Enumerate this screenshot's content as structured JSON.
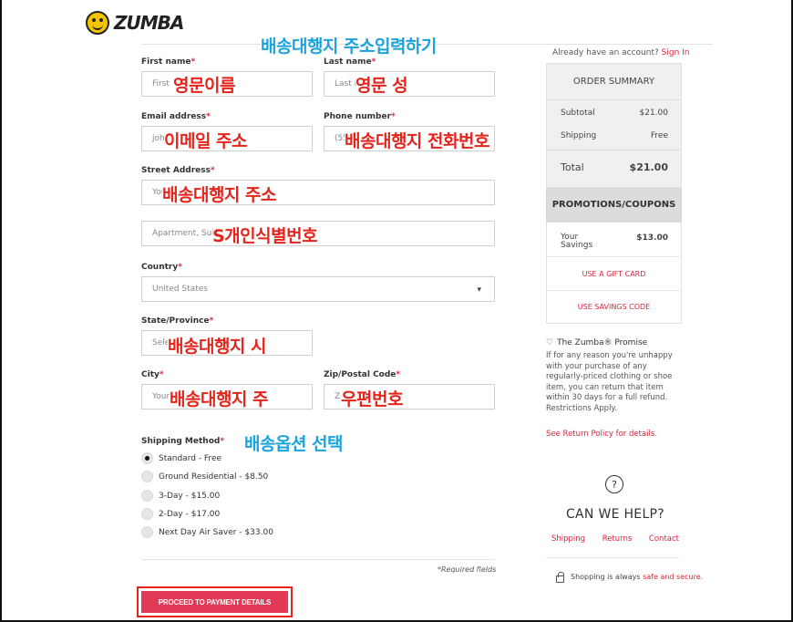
{
  "brand": {
    "logo_text": "ZUMBA"
  },
  "overlays": {
    "title": "배송대행지 주소입력하기",
    "first_name": "영문이름",
    "last_name": "영문 성",
    "email": "이메일 주소",
    "phone": "배송대행지 전화번호",
    "street": "배송대행지 주소",
    "apartment": "S개인식별번호",
    "state": "배송대행지 시",
    "city": "배송대행지 주",
    "zip": "우편번호",
    "shipping": "배송옵션 선택"
  },
  "form": {
    "first_name": {
      "label": "First name",
      "req": "*",
      "placeholder": "First"
    },
    "last_name": {
      "label": "Last name",
      "req": "*",
      "placeholder": "Last n"
    },
    "email": {
      "label": "Email address",
      "req": "*",
      "placeholder": "joh"
    },
    "phone": {
      "label": "Phone number",
      "req": "*",
      "placeholder": "(55"
    },
    "street": {
      "label": "Street Address",
      "req": "*",
      "placeholder": "You"
    },
    "apartment": {
      "placeholder": "Apartment, Suit"
    },
    "country": {
      "label": "Country",
      "req": "*",
      "value": "United States"
    },
    "state": {
      "label": "State/Province",
      "req": "*",
      "placeholder": "Sele"
    },
    "city": {
      "label": "City",
      "req": "*",
      "placeholder": "Your"
    },
    "zip": {
      "label": "Zip/Postal Code",
      "req": "*",
      "placeholder": "Z"
    },
    "shipping_method": {
      "label": "Shipping Method",
      "req": "*",
      "options": [
        {
          "label": "Standard - Free",
          "checked": true
        },
        {
          "label": "Ground Residential - $8.50",
          "checked": false
        },
        {
          "label": "3-Day - $15.00",
          "checked": false
        },
        {
          "label": "2-Day - $17.00",
          "checked": false
        },
        {
          "label": "Next Day Air Saver - $33.00",
          "checked": false
        }
      ]
    },
    "required_note": "*Required fields",
    "proceed_button": "PROCEED TO PAYMENT DETAILS"
  },
  "sidebar": {
    "account_text": "Already have an account?",
    "sign_in": "Sign In",
    "order_summary": {
      "title": "ORDER SUMMARY",
      "subtotal_label": "Subtotal",
      "subtotal_value": "$21.00",
      "shipping_label": "Shipping",
      "shipping_value": "Free",
      "total_label": "Total",
      "total_value": "$21.00"
    },
    "promotions_title": "PROMOTIONS/COUPONS",
    "savings": {
      "label_line1": "Your",
      "label_line2": "Savings",
      "value": "$13.00",
      "gift_card": "USE A GIFT CARD",
      "savings_code": "USE SAVINGS CODE"
    },
    "promise": {
      "title": "The Zumba® Promise",
      "body": "If for any reason you're unhappy with your purchase of any regularly-priced clothing or shoe item, you can return that item within 30 days for a full refund. Restrictions Apply.",
      "link": "See Return Policy for details."
    },
    "help": {
      "icon_glyph": "?",
      "title": "CAN WE HELP?",
      "links": [
        "Shipping",
        "Returns",
        "Contact"
      ]
    },
    "secure": {
      "text": "Shopping is always",
      "highlight": "safe and secure."
    }
  }
}
